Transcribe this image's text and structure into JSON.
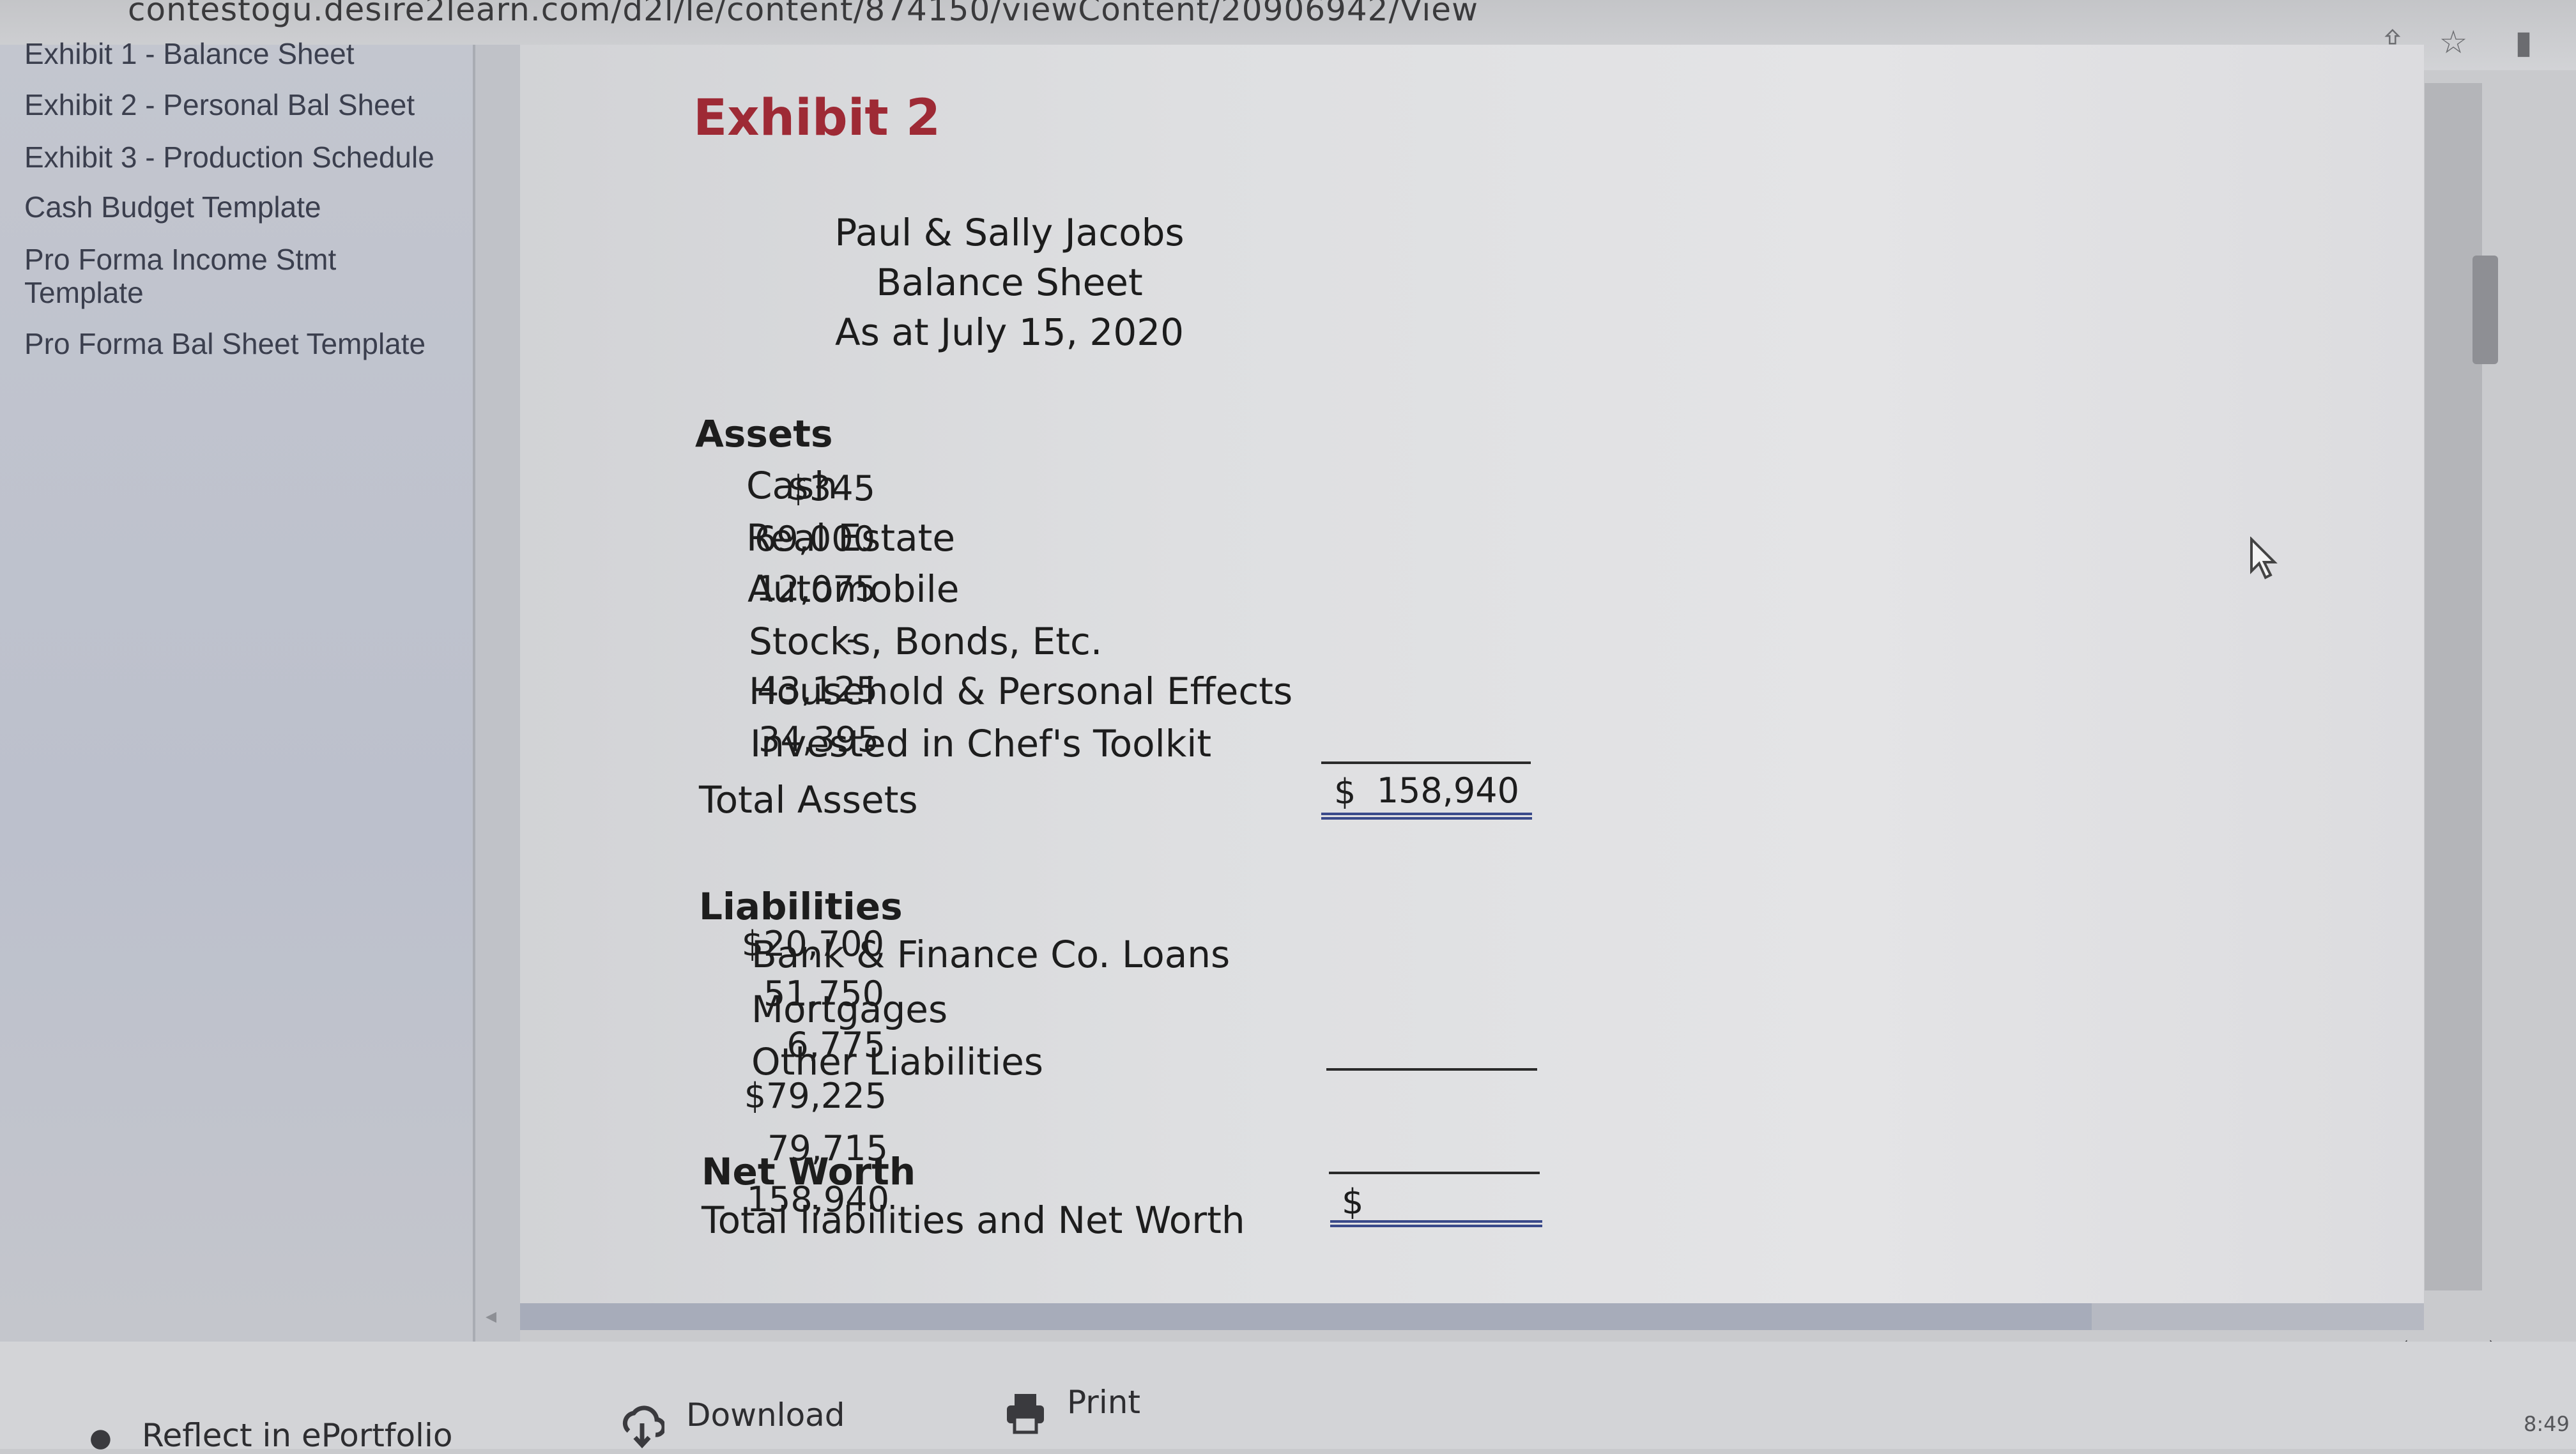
{
  "browser": {
    "url": "contestogu.desire2learn.com/d2l/le/content/874150/viewContent/20906942/View",
    "icons": [
      "share-icon",
      "star-icon",
      "sidebar-icon"
    ]
  },
  "sidebar": {
    "items": [
      {
        "label": "Exhibit 1 - Balance Sheet"
      },
      {
        "label": "Exhibit 2 - Personal Bal Sheet"
      },
      {
        "label": "Exhibit 3 - Production Schedule"
      },
      {
        "label": "Cash Budget Template"
      },
      {
        "label": "Pro Forma Income Stmt Template"
      },
      {
        "label": "Pro Forma Bal Sheet Template"
      }
    ]
  },
  "document": {
    "exhibit_title": "Exhibit 2",
    "heading": {
      "name": "Paul & Sally Jacobs",
      "statement": "Balance Sheet",
      "date": "As at July 15, 2020"
    },
    "assets": {
      "header": "Assets",
      "rows": [
        {
          "label": "Cash",
          "value": "$345"
        },
        {
          "label": "Real Estate",
          "value": "69,000"
        },
        {
          "label": "Automobile",
          "value": "12,075"
        },
        {
          "label": "Stocks, Bonds, Etc.",
          "value": "-"
        },
        {
          "label": "Household & Personal Effects",
          "value": "43,125"
        },
        {
          "label": "Invested in Chef's Toolkit",
          "value": "34,395"
        }
      ],
      "total_label": "Total Assets",
      "total_currency": "$",
      "total_value": "158,940"
    },
    "liabilities": {
      "header": "Liabilities",
      "rows": [
        {
          "label": "Bank & Finance Co. Loans",
          "value": "$20,700"
        },
        {
          "label": "Mortgages",
          "value": "51,750"
        },
        {
          "label": "Other Liabilities",
          "value": "6,775"
        }
      ],
      "subtotal": "$79,225"
    },
    "net_worth": {
      "label": "Net Worth",
      "value": "79,715"
    },
    "total_liabilities_net_worth": {
      "label": "Total liabilities and Net Worth",
      "currency": "$",
      "value": "158,940"
    }
  },
  "bottom_bar": {
    "reflect_label": "Reflect in ePortfolio",
    "download_label": "Download",
    "print_label": "Print",
    "prev_label": "‹",
    "next_label": "›",
    "clock": "8:49"
  }
}
